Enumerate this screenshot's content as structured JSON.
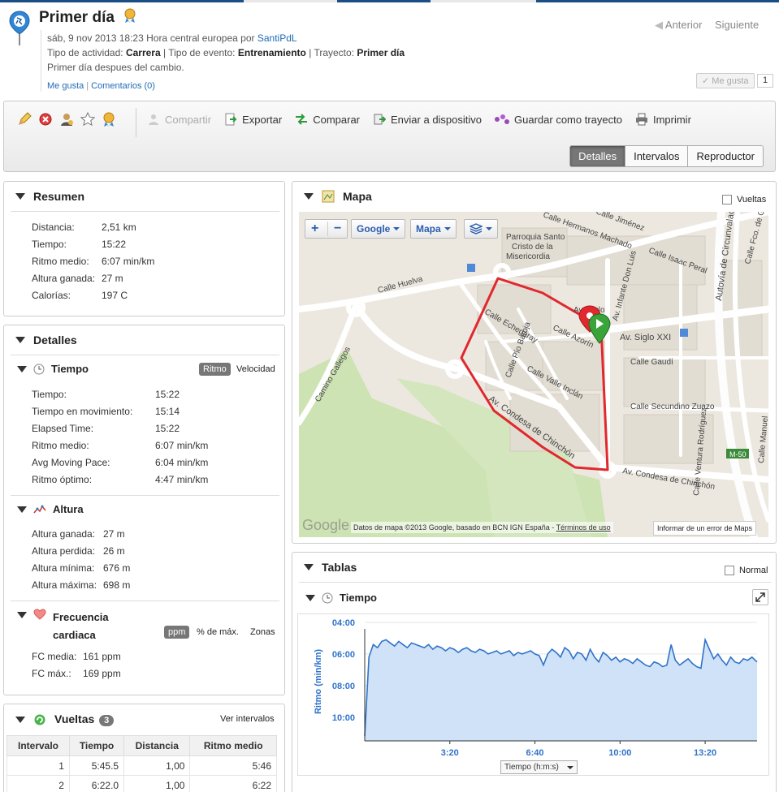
{
  "header": {
    "title": "Primer día",
    "meta_prefix": "sáb, 9 nov 2013 18:23 Hora central europea por",
    "author": "SantiPdL",
    "activity_label": "Tipo de actividad:",
    "activity_value": "Carrera",
    "event_label": "| Tipo de evento:",
    "event_value": "Entrenamiento",
    "route_label": "| Trayecto:",
    "route_value": "Primer día",
    "description": "Primer día despues del cambio.",
    "like_link": "Me gusta",
    "comments_link": "Comentarios (0)",
    "prev": "Anterior",
    "next": "Siguiente",
    "like_button": "Me gusta",
    "like_count": "1"
  },
  "toolbar": {
    "share": "Compartir",
    "export": "Exportar",
    "compare": "Comparar",
    "send": "Enviar a dispositivo",
    "save_route": "Guardar como trayecto",
    "print": "Imprimir",
    "tabs": [
      "Detalles",
      "Intervalos",
      "Reproductor"
    ]
  },
  "summary": {
    "title": "Resumen",
    "rows": [
      {
        "k": "Distancia:",
        "v": "2,51 km"
      },
      {
        "k": "Tiempo:",
        "v": "15:22"
      },
      {
        "k": "Ritmo medio:",
        "v": "6:07 min/km"
      },
      {
        "k": "Altura ganada:",
        "v": "27 m"
      },
      {
        "k": "Calorías:",
        "v": "197 C"
      }
    ]
  },
  "details": {
    "title": "Detalles",
    "time": {
      "title": "Tiempo",
      "toggle_on": "Ritmo",
      "toggle_off": "Velocidad",
      "rows": [
        {
          "k": "Tiempo:",
          "v": "15:22"
        },
        {
          "k": "Tiempo en movimiento:",
          "v": "15:14"
        },
        {
          "k": "Elapsed Time:",
          "v": "15:22"
        },
        {
          "k": "Ritmo medio:",
          "v": "6:07 min/km"
        },
        {
          "k": "Avg Moving Pace:",
          "v": "6:04 min/km"
        },
        {
          "k": "Ritmo óptimo:",
          "v": "4:47 min/km"
        }
      ]
    },
    "altitude": {
      "title": "Altura",
      "rows": [
        {
          "k": "Altura ganada:",
          "v": "27 m"
        },
        {
          "k": "Altura perdida:",
          "v": "26 m"
        },
        {
          "k": "Altura mínima:",
          "v": "676 m"
        },
        {
          "k": "Altura máxima:",
          "v": "698 m"
        }
      ]
    },
    "hr": {
      "title1": "Frecuencia",
      "title2": "cardiaca",
      "opt1": "ppm",
      "opt2": "% de máx.",
      "opt3": "Zonas",
      "rows": [
        {
          "k": "FC media:",
          "v": "161 ppm"
        },
        {
          "k": "FC máx.:",
          "v": "169 ppm"
        }
      ]
    }
  },
  "laps": {
    "title": "Vueltas",
    "count": "3",
    "link": "Ver intervalos",
    "columns": [
      "Intervalo",
      "Tiempo",
      "Distancia",
      "Ritmo medio"
    ],
    "rows": [
      [
        "1",
        "5:45.5",
        "1,00",
        "5:46"
      ],
      [
        "2",
        "6:22.0",
        "1,00",
        "6:22"
      ]
    ]
  },
  "map": {
    "title": "Mapa",
    "laps_checkbox": "Vueltas",
    "provider": "Google",
    "type": "Mapa",
    "attribution": "Datos de mapa ©2013 Google, basado en BCN IGN España -",
    "terms": "Términos de uso",
    "report": "Informar de un error de Maps",
    "logo": "Google",
    "streets": [
      "Calle Hermanos Machado",
      "Calle Jiménez",
      "Parroquia Santo",
      "Cristo de la",
      "Misericordia",
      "Calle Isaac Peral",
      "Calle Fco. de Goya",
      "Av. Infante Don Luis",
      "Autovía de Circunvalación",
      "Calle Huelva",
      "Calle Echegaray",
      "Calle Azorín",
      "Av. Siglo XXI",
      "Av. Siglo",
      "Calle Gaudí",
      "Camino Gallegos",
      "Calle Pío Baroja",
      "Calle Valle Inclán",
      "Calle Secundino Zuazo",
      "Av. Condesa de Chinchón",
      "Calle Ventura Rodríguez",
      "Calle Manuel",
      "M-50",
      "Av. Condesa de Chinchón"
    ]
  },
  "tables": {
    "title": "Tablas",
    "normal_checkbox": "Normal",
    "chart_title": "Tiempo",
    "x_select": "Tiempo (h:m:s)"
  },
  "chart_data": {
    "type": "area",
    "title": "",
    "xlabel": "Tiempo (h:m:s)",
    "ylabel": "Ritmo (min/km)",
    "x_ticks": [
      "3:20",
      "6:40",
      "10:00",
      "13:20"
    ],
    "y_ticks": [
      "04:00",
      "06:00",
      "08:00",
      "10:00"
    ],
    "y_inverted": true,
    "xlim_seconds": [
      0,
      922
    ],
    "ylim_minutes": [
      4,
      11.5
    ],
    "x_seconds": [
      0,
      10,
      20,
      30,
      40,
      50,
      60,
      70,
      80,
      90,
      100,
      110,
      120,
      130,
      140,
      150,
      160,
      170,
      180,
      190,
      200,
      210,
      220,
      230,
      240,
      250,
      260,
      270,
      280,
      290,
      300,
      310,
      320,
      330,
      340,
      350,
      360,
      370,
      380,
      390,
      400,
      410,
      420,
      430,
      440,
      450,
      460,
      470,
      480,
      490,
      500,
      510,
      520,
      530,
      540,
      550,
      560,
      570,
      580,
      590,
      600,
      610,
      620,
      630,
      640,
      650,
      660,
      670,
      680,
      690,
      700,
      710,
      720,
      730,
      740,
      750,
      760,
      770,
      780,
      790,
      800,
      810,
      820,
      830,
      840,
      850,
      860,
      870,
      880,
      890,
      900,
      910,
      922
    ],
    "pace_minutes": [
      11.2,
      6.2,
      5.4,
      5.6,
      5.2,
      5.1,
      5.3,
      5.5,
      5.2,
      5.4,
      5.6,
      5.3,
      5.4,
      5.5,
      5.6,
      5.4,
      5.7,
      5.5,
      5.6,
      5.8,
      5.6,
      5.7,
      5.9,
      5.7,
      5.6,
      5.8,
      5.9,
      5.7,
      5.8,
      6.0,
      5.9,
      5.8,
      6.0,
      5.9,
      5.8,
      6.1,
      5.9,
      6.0,
      5.9,
      5.8,
      6.0,
      6.1,
      6.7,
      6.0,
      5.7,
      5.9,
      6.2,
      5.6,
      5.8,
      6.3,
      5.9,
      6.0,
      6.4,
      5.7,
      6.2,
      6.5,
      5.9,
      6.1,
      6.4,
      6.2,
      6.5,
      6.3,
      6.4,
      6.6,
      6.3,
      6.5,
      6.7,
      6.8,
      6.5,
      6.6,
      6.8,
      6.7,
      5.4,
      6.4,
      6.7,
      6.5,
      6.3,
      6.6,
      6.8,
      6.9,
      5.1,
      5.7,
      6.3,
      6.0,
      6.4,
      6.7,
      6.2,
      6.5,
      6.6,
      6.3,
      6.4,
      6.2,
      6.5
    ]
  },
  "colors": {
    "link": "#1f6bb5",
    "chart_line": "#2f73c9",
    "chart_fill": "#cfe2f7",
    "route": "#e0282e",
    "park": "#cde3b4"
  }
}
